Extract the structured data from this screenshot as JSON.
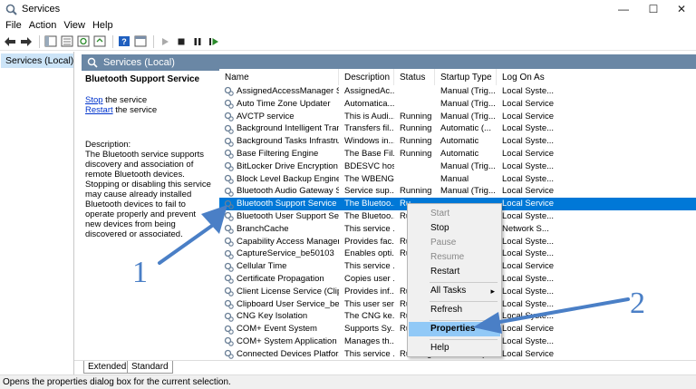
{
  "window": {
    "title": "Services",
    "minimize": "—",
    "maximize": "☐",
    "close": "✕"
  },
  "menu": [
    "File",
    "Action",
    "View",
    "Help"
  ],
  "tree": {
    "item": "Services (Local)"
  },
  "panel_header": "Services (Local)",
  "details": {
    "service_name": "Bluetooth Support Service",
    "stop_link": "Stop",
    "stop_suffix": " the service",
    "restart_link": "Restart",
    "restart_suffix": " the service",
    "description_label": "Description:",
    "description": "The Bluetooth service supports discovery and association of remote Bluetooth devices.  Stopping or disabling this service may cause already installed Bluetooth devices to fail to operate properly and prevent new devices from being discovered or associated."
  },
  "columns": [
    "Name",
    "Description",
    "Status",
    "Startup Type",
    "Log On As"
  ],
  "services": [
    [
      "AssignedAccessManager Se...",
      "AssignedAc...",
      "",
      "Manual (Trig...",
      "Local Syste..."
    ],
    [
      "Auto Time Zone Updater",
      "Automatica...",
      "",
      "Manual (Trig...",
      "Local Service"
    ],
    [
      "AVCTP service",
      "This is Audi...",
      "Running",
      "Manual (Trig...",
      "Local Service"
    ],
    [
      "Background Intelligent Tran...",
      "Transfers fil...",
      "Running",
      "Automatic (...",
      "Local Syste..."
    ],
    [
      "Background Tasks Infrastruc...",
      "Windows in...",
      "Running",
      "Automatic",
      "Local Syste..."
    ],
    [
      "Base Filtering Engine",
      "The Base Fil...",
      "Running",
      "Automatic",
      "Local Service"
    ],
    [
      "BitLocker Drive Encryption ...",
      "BDESVC hos...",
      "",
      "Manual (Trig...",
      "Local Syste..."
    ],
    [
      "Block Level Backup Engine ...",
      "The WBENG...",
      "",
      "Manual",
      "Local Syste..."
    ],
    [
      "Bluetooth Audio Gateway S...",
      "Service sup...",
      "Running",
      "Manual (Trig...",
      "Local Service"
    ],
    [
      "Bluetooth Support Service",
      "The Bluetoo...",
      "Ru",
      "",
      "Local Service"
    ],
    [
      "Bluetooth User Support Ser...",
      "The Bluetoo...",
      "Ru",
      "",
      "Local Syste..."
    ],
    [
      "BranchCache",
      "This service ...",
      "",
      "",
      "Network S..."
    ],
    [
      "Capability Access Manager ...",
      "Provides fac...",
      "Ru",
      "",
      "Local Syste..."
    ],
    [
      "CaptureService_be50103",
      "Enables opti...",
      "Ru",
      "",
      "Local Syste..."
    ],
    [
      "Cellular Time",
      "This service ...",
      "",
      "",
      "Local Service"
    ],
    [
      "Certificate Propagation",
      "Copies user ...",
      "",
      "",
      "Local Syste..."
    ],
    [
      "Client License Service (ClipS...",
      "Provides inf...",
      "Ru",
      "",
      "Local Syste..."
    ],
    [
      "Clipboard User Service_be5...",
      "This user ser...",
      "Ru",
      "",
      "Local Syste..."
    ],
    [
      "CNG Key Isolation",
      "The CNG ke...",
      "Ru",
      "",
      "Local Syste..."
    ],
    [
      "COM+ Event System",
      "Supports Sy...",
      "Ru",
      "",
      "Local Service"
    ],
    [
      "COM+ System Application",
      "Manages th...",
      "",
      "",
      "Local Syste..."
    ],
    [
      "Connected Devices Platfor...",
      "This service ...",
      "Running",
      "Automatic (...",
      "Local Service"
    ]
  ],
  "context_menu": {
    "start": "Start",
    "stop": "Stop",
    "pause": "Pause",
    "resume": "Resume",
    "restart": "Restart",
    "all_tasks": "All Tasks",
    "refresh": "Refresh",
    "properties": "Properties",
    "help": "Help"
  },
  "tabs": [
    "Extended",
    "Standard"
  ],
  "status_text": "Opens the properties dialog box for the current selection.",
  "annotations": {
    "label1": "1",
    "label2": "2",
    "color": "#4a7fc6"
  },
  "colors": {
    "selection": "#0078d7",
    "header": "#6a87a5",
    "menu_highlight": "#91c9f7"
  }
}
